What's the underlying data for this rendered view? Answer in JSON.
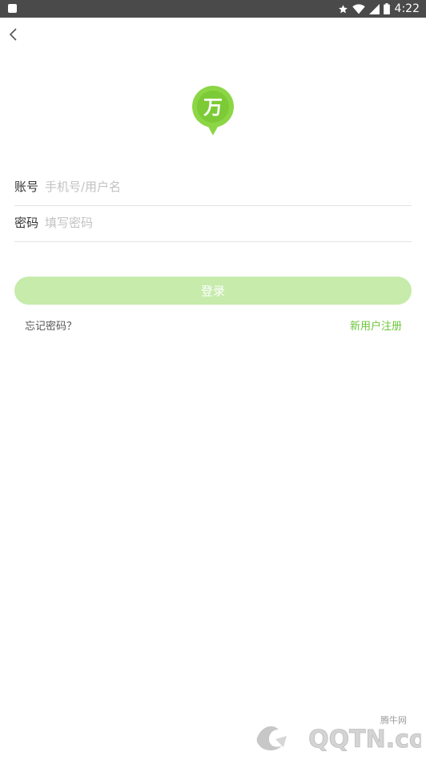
{
  "status_bar": {
    "time": "4:22",
    "icons": [
      "app-notification-icon",
      "star-icon",
      "wifi-icon",
      "cell-signal-icon",
      "battery-icon"
    ]
  },
  "nav": {
    "back_icon": "chevron-left-icon"
  },
  "logo": {
    "glyph": "万",
    "color": "#8cd646"
  },
  "form": {
    "account_label": "账号",
    "account_placeholder": "手机号/用户名",
    "password_label": "密码",
    "password_placeholder": "填写密码"
  },
  "login_button": {
    "label": "登录",
    "color": "#c6ebab"
  },
  "links": {
    "forgot_password": "忘记密码？",
    "register": "新用户注册"
  },
  "watermark": {
    "name": "腾牛网",
    "brand": "QQTN.com"
  },
  "colors": {
    "accent_green": "#6cc63a",
    "status_bar": "#4a4a4a",
    "divider": "#e3e3e3",
    "placeholder": "#c2c2c2"
  }
}
